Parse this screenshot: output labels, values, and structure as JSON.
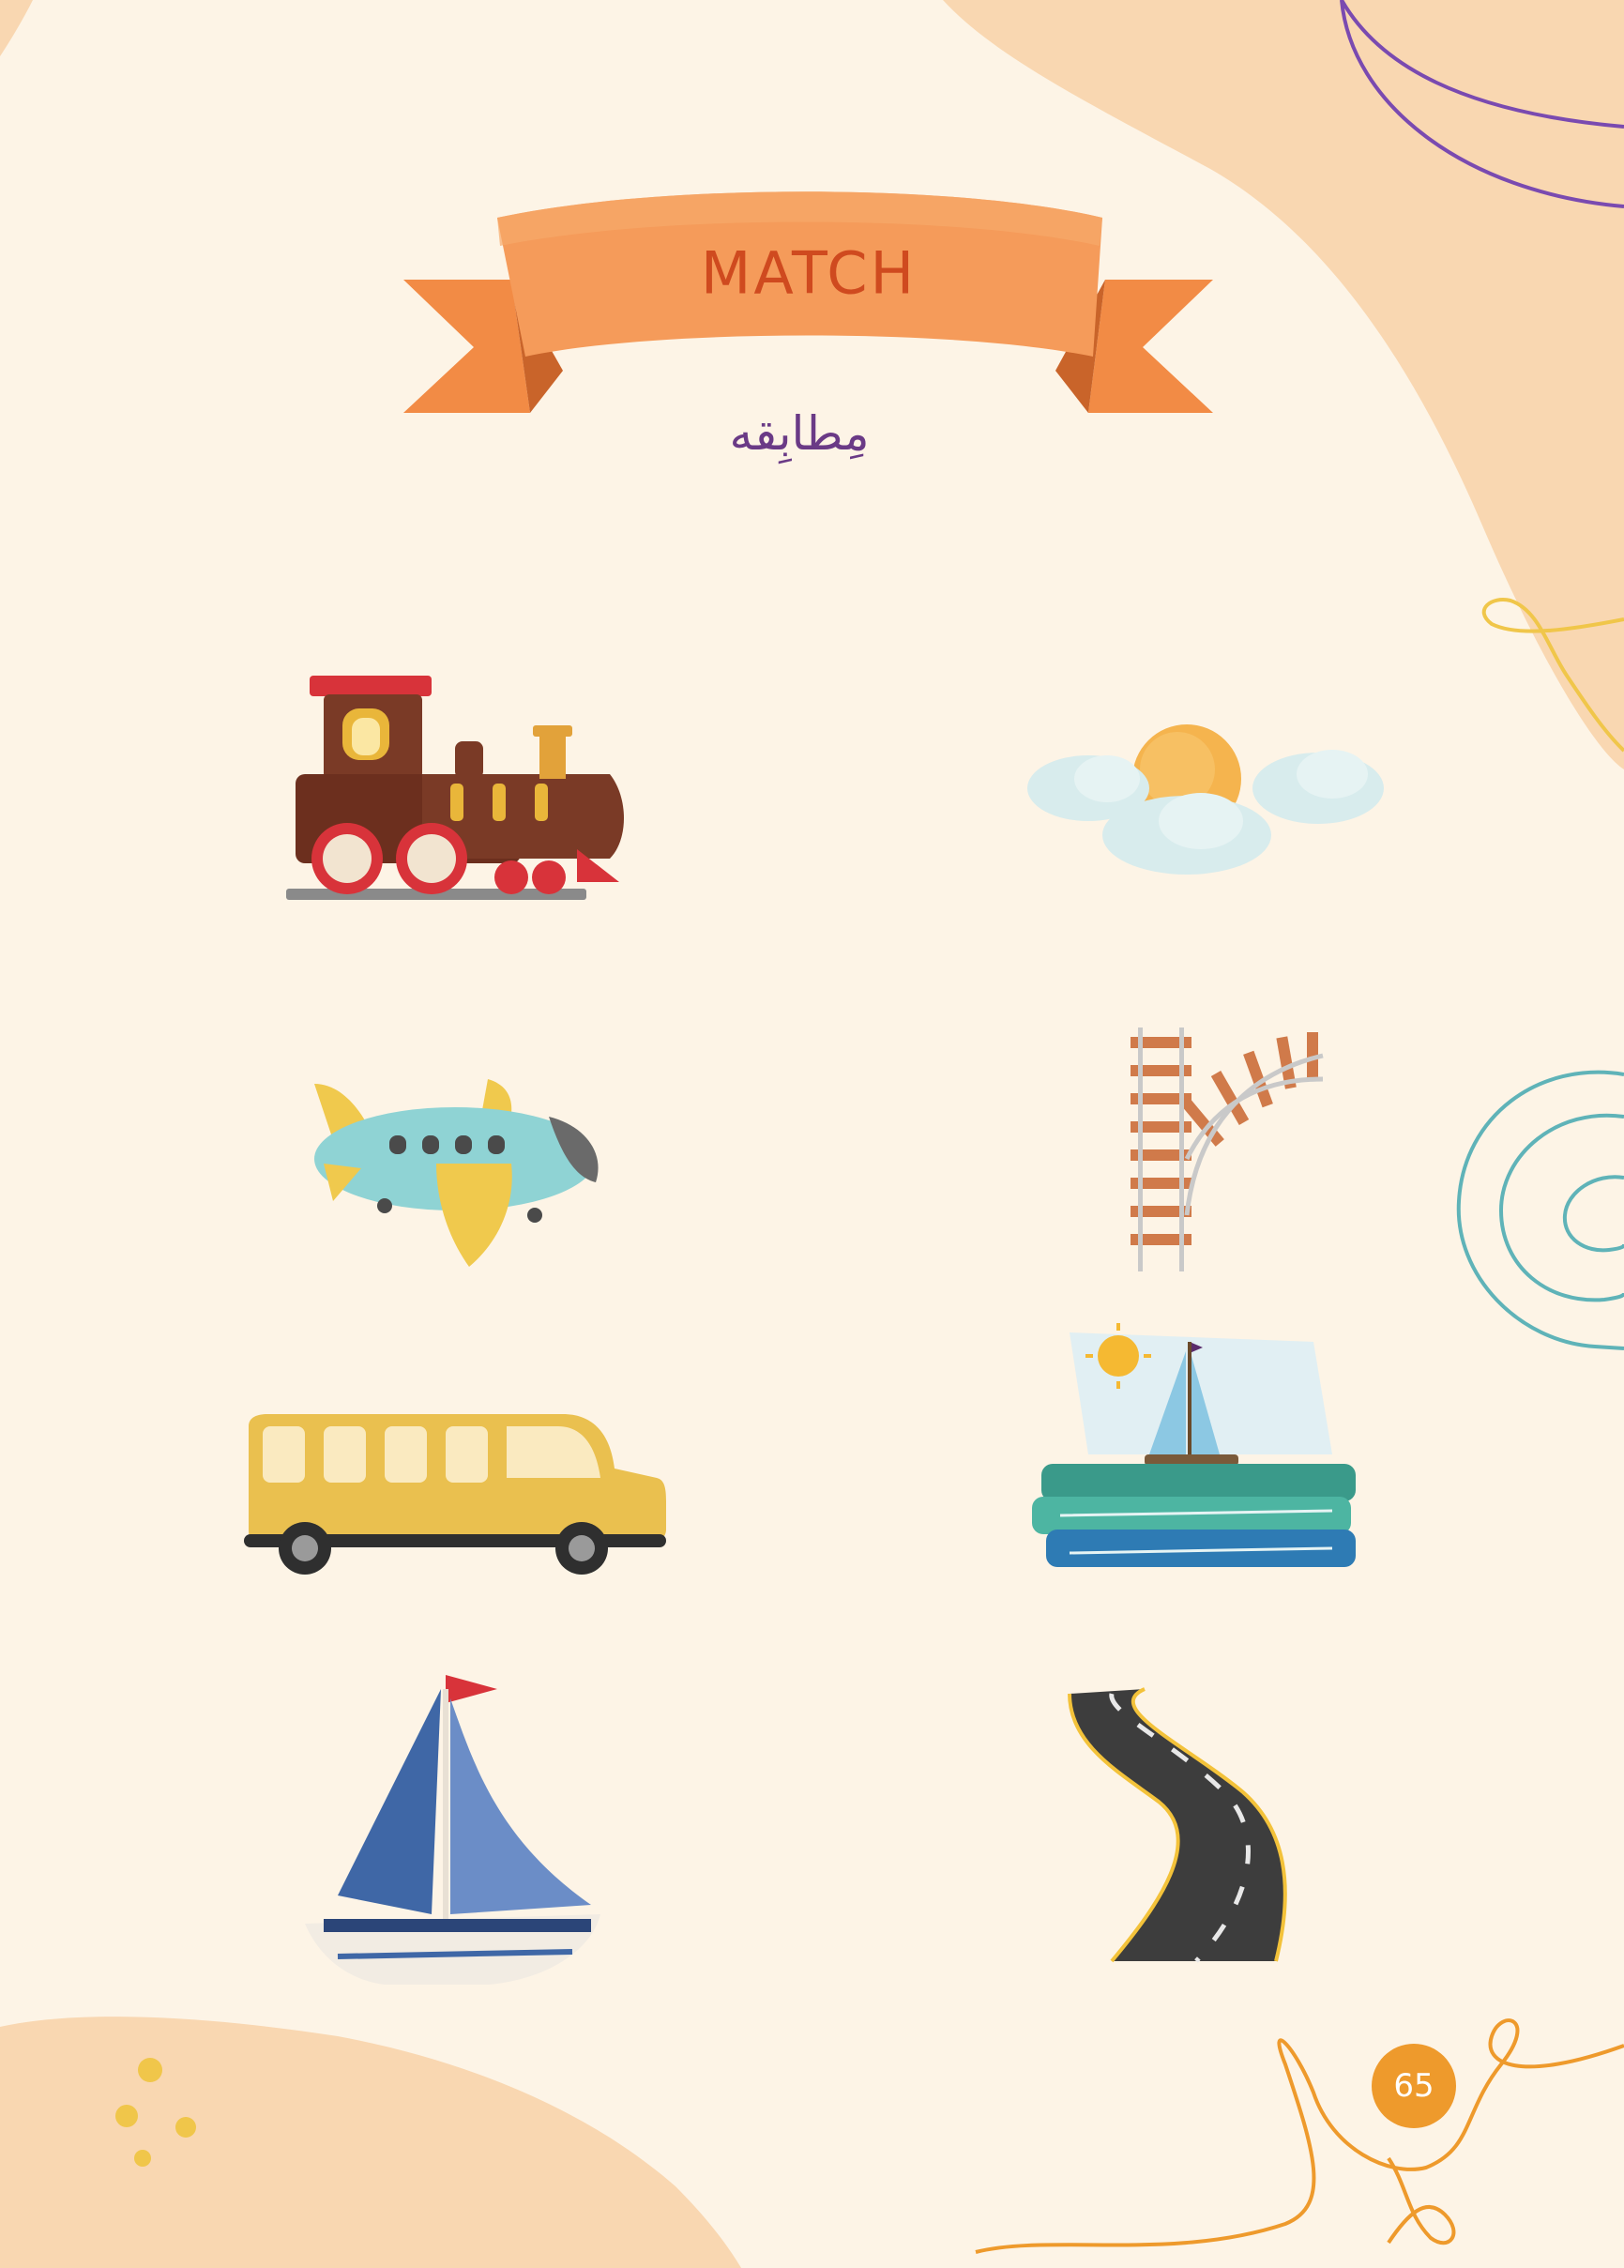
{
  "banner": {
    "title": "MATCH",
    "subtitle": "مِطابِقه"
  },
  "page": {
    "number": "65"
  },
  "colors": {
    "background": "#fdf4e6",
    "blob": "#f9d7b1",
    "banner_orange": "#f4914f",
    "title_text": "#cf4a1f",
    "subtitle_text": "#6a3a86",
    "page_badge": "#ee9a2c"
  },
  "left_column": [
    "train",
    "airplane",
    "bus",
    "sailboat"
  ],
  "right_column": [
    "sun-and-clouds",
    "railway-track",
    "boat-on-sea",
    "road"
  ]
}
